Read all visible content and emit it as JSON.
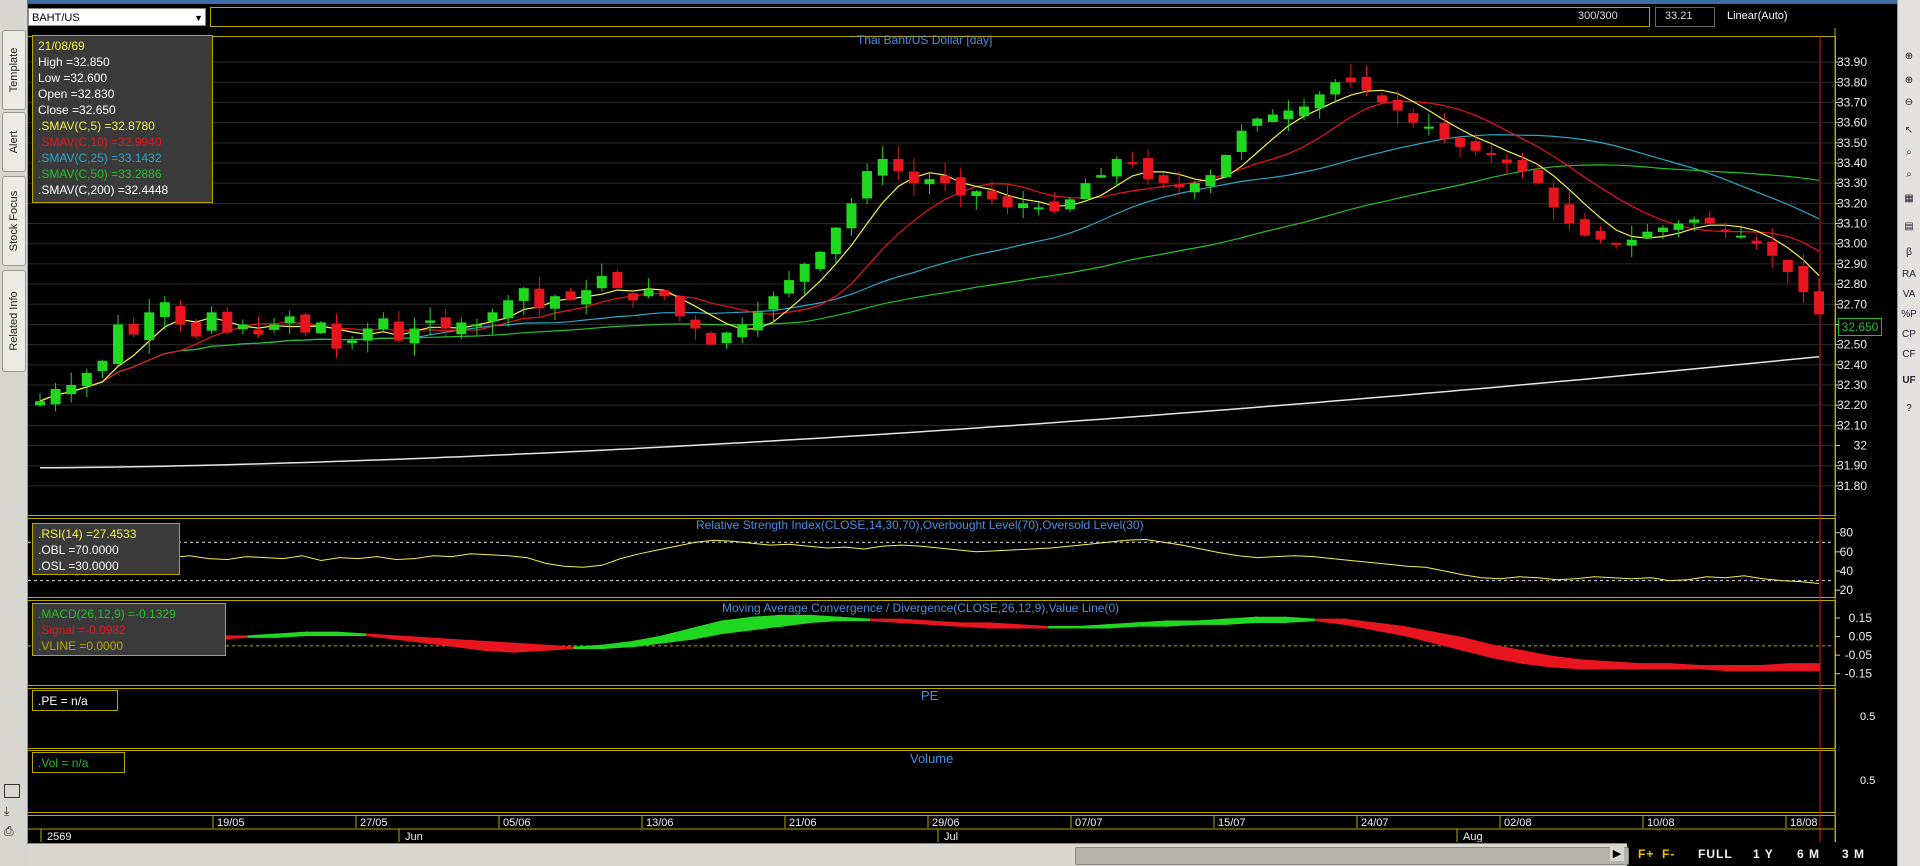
{
  "symbol": "BAHT/US",
  "header": {
    "bars": "300/300",
    "last": "33.21",
    "scale": "Linear(Auto)"
  },
  "side_tabs": [
    "Template",
    "Alert",
    "Stock Focus",
    "Related Info"
  ],
  "right_toolbar": [
    "β",
    "RA",
    "VA",
    "%P",
    "CP",
    "CF",
    "UF"
  ],
  "ohlc": {
    "date": "21/08/69",
    "high": "High  =32.850",
    "low": "Low   =32.600",
    "open": "Open  =32.830",
    "close": "Close =32.650"
  },
  "sma_labels": [
    ".SMAV(C,5)    =32.8780",
    ".SMAV(C,10)   =32.9940",
    ".SMAV(C,25)   =33.1432",
    ".SMAV(C,50)   =33.2886",
    ".SMAV(C,200)   =32.4448"
  ],
  "price_badge": "32.650",
  "rsi": {
    "title": "Relative Strength Index(CLOSE,14,30,70),Overbought Level(70),Oversold Level(30)",
    "l1": ".RSI(14)   =27.4533",
    "l2": ".OBL   =70.0000",
    "l3": ".OSL   =30.0000"
  },
  "macd": {
    "title": "Moving Average Convergence / Divergence(CLOSE,26,12,9),Value Line(0)",
    "l1": ".MACD(26,12,9)   =-0.1329",
    "l2": ".Signal   =-0.0982",
    "l3": ".VLINE   =0.0000"
  },
  "pe": {
    "title": "PE",
    "label": ".PE   = n/a",
    "tick": "0.5"
  },
  "vol": {
    "title": "Volume",
    "label": ".Vol   = n/a",
    "tick": "0.5"
  },
  "controls": {
    "f_plus": "F+",
    "f_minus": "F-",
    "full": "FULL",
    "y1": "1 Y",
    "m6": "6 M",
    "m3": "3 M"
  },
  "colors": {
    "up": "#1fd81f",
    "down": "#e8141e",
    "sma5": "#f2f24d",
    "sma10": "#e8141e",
    "sma25": "#2aa7c9",
    "sma50": "#22c02a",
    "sma200": "#e6e6e6",
    "grid": "#b8a800",
    "title": "#4a8fe0"
  },
  "chart_data": [
    {
      "type": "candlestick",
      "title": "Thai Baht/US Dollar [day]",
      "ylim": [
        31.75,
        33.95
      ],
      "y_ticks": [
        "33.90",
        "33.80",
        "33.70",
        "33.60",
        "33.50",
        "33.40",
        "33.30",
        "33.20",
        "33.10",
        "33.00",
        "32.90",
        "32.80",
        "32.70",
        "32.60",
        "32.50",
        "32.40",
        "32.30",
        "32.20",
        "32.10",
        "32",
        "31.90",
        "31.80"
      ],
      "date_ticks": [
        "19/05",
        "27/05",
        "05/06",
        "13/06",
        "21/06",
        "29/06",
        "07/07",
        "15/07",
        "24/07",
        "02/08",
        "10/08",
        "18/08"
      ],
      "month_ticks": [
        "2569",
        "Jun",
        "Jul",
        "Aug"
      ],
      "closes": [
        32.22,
        32.28,
        32.3,
        32.36,
        32.42,
        32.6,
        32.55,
        32.66,
        32.71,
        32.6,
        32.54,
        32.66,
        32.56,
        32.6,
        32.55,
        32.6,
        32.64,
        32.56,
        32.61,
        32.48,
        32.52,
        32.58,
        32.63,
        32.52,
        32.58,
        32.62,
        32.58,
        32.61,
        32.6,
        32.66,
        32.72,
        32.78,
        32.68,
        32.74,
        32.72,
        32.77,
        32.84,
        32.78,
        32.72,
        32.77,
        32.74,
        32.64,
        32.58,
        32.5,
        32.56,
        32.6,
        32.66,
        32.74,
        32.82,
        32.9,
        32.96,
        33.08,
        33.2,
        33.36,
        33.42,
        33.36,
        33.3,
        33.32,
        33.3,
        33.24,
        33.26,
        33.22,
        33.18,
        33.2,
        33.18,
        33.16,
        33.22,
        33.3,
        33.34,
        33.42,
        33.4,
        33.32,
        33.3,
        33.28,
        33.3,
        33.34,
        33.44,
        33.56,
        33.62,
        33.64,
        33.66,
        33.68,
        33.74,
        33.8,
        33.8,
        33.76,
        33.7,
        33.66,
        33.6,
        33.58,
        33.52,
        33.48,
        33.46,
        33.44,
        33.4,
        33.36,
        33.3,
        33.18,
        33.1,
        33.04,
        33.02,
        33.0,
        33.02,
        33.06,
        33.08,
        33.1,
        33.12,
        33.1,
        33.06,
        33.04,
        33.0,
        32.94,
        32.86,
        32.76,
        32.65
      ],
      "series": [
        {
          "name": ".SMAV(C,5)"
        },
        {
          "name": ".SMAV(C,10)"
        },
        {
          "name": ".SMAV(C,25)"
        },
        {
          "name": ".SMAV(C,50)"
        },
        {
          "name": ".SMAV(C,200)"
        }
      ]
    },
    {
      "type": "line",
      "title": "Relative Strength Index(CLOSE,14,30,70),Overbought Level(70),Oversold Level(30)",
      "ylim": [
        15,
        88
      ],
      "y_ticks": [
        "80",
        "60",
        "40",
        "20"
      ],
      "overbought": 70,
      "oversold": 30,
      "values": [
        55,
        54,
        56,
        55,
        57,
        52,
        55,
        54,
        56,
        53,
        52,
        55,
        54,
        53,
        56,
        51,
        54,
        53,
        55,
        52,
        53,
        56,
        55,
        58,
        57,
        56,
        54,
        48,
        45,
        44,
        46,
        53,
        58,
        62,
        66,
        70,
        72,
        71,
        69,
        67,
        68,
        66,
        64,
        65,
        63,
        66,
        67,
        66,
        64,
        62,
        60,
        61,
        62,
        63,
        64,
        66,
        68,
        70,
        72,
        73,
        70,
        67,
        63,
        59,
        56,
        54,
        55,
        56,
        55,
        53,
        51,
        49,
        47,
        45,
        44,
        40,
        36,
        33,
        32,
        34,
        33,
        31,
        32,
        34,
        33,
        32,
        33,
        30,
        31,
        34,
        33,
        35,
        32,
        30,
        29,
        27
      ]
    },
    {
      "type": "area",
      "title": "Moving Average Convergence / Divergence(CLOSE,26,12,9),Value Line(0)",
      "ylim": [
        -0.2,
        0.22
      ],
      "y_ticks": [
        "0.15",
        "0.05",
        "-0.05",
        "-0.15"
      ],
      "macd": [
        0.05,
        0.05,
        0.05,
        0.06,
        0.05,
        0.04,
        0.04,
        0.05,
        0.06,
        0.07,
        0.07,
        0.06,
        0.04,
        0.02,
        0.0,
        -0.02,
        -0.03,
        -0.02,
        -0.01,
        0.0,
        0.02,
        0.05,
        0.09,
        0.13,
        0.15,
        0.16,
        0.16,
        0.15,
        0.14,
        0.13,
        0.12,
        0.11,
        0.1,
        0.1,
        0.1,
        0.1,
        0.11,
        0.12,
        0.13,
        0.13,
        0.14,
        0.15,
        0.15,
        0.14,
        0.12,
        0.09,
        0.06,
        0.02,
        -0.02,
        -0.06,
        -0.09,
        -0.11,
        -0.12,
        -0.12,
        -0.12,
        -0.12,
        -0.12,
        -0.13,
        -0.13,
        -0.13,
        -0.13
      ],
      "signal": [
        0.06,
        0.05,
        0.05,
        0.05,
        0.05,
        0.05,
        0.05,
        0.05,
        0.05,
        0.06,
        0.06,
        0.06,
        0.05,
        0.04,
        0.03,
        0.02,
        0.01,
        0.0,
        -0.01,
        -0.01,
        0.0,
        0.02,
        0.04,
        0.07,
        0.09,
        0.11,
        0.13,
        0.14,
        0.14,
        0.14,
        0.13,
        0.12,
        0.12,
        0.11,
        0.1,
        0.1,
        0.1,
        0.11,
        0.11,
        0.12,
        0.12,
        0.13,
        0.13,
        0.14,
        0.14,
        0.12,
        0.1,
        0.07,
        0.04,
        0.0,
        -0.03,
        -0.06,
        -0.08,
        -0.09,
        -0.1,
        -0.1,
        -0.11,
        -0.11,
        -0.11,
        -0.1,
        -0.1
      ]
    }
  ]
}
